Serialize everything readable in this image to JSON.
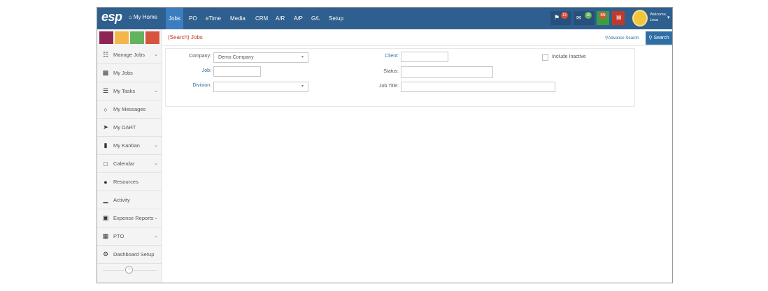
{
  "brand": "esp",
  "nav": {
    "home_label": "My Home",
    "items": [
      "Jobs",
      "PO",
      "eTime",
      "Media",
      "CRM",
      "A/R",
      "A/P",
      "G/L",
      "Setup"
    ],
    "active": "Jobs"
  },
  "header": {
    "badges": {
      "alerts": "13",
      "messages": "18",
      "user_initials": "BN"
    },
    "welcome_line1": "Welcome,",
    "welcome_line2": "Lesa"
  },
  "colors": {
    "nav_bg": "#2f5f8f",
    "swatches": [
      "#8e2451",
      "#f3b64a",
      "#62b35d",
      "#d7553f"
    ]
  },
  "sidebar": {
    "items": [
      {
        "label": "Manage Jobs",
        "icon": "sitemap-icon",
        "chevron": true
      },
      {
        "label": "My Jobs",
        "icon": "folder-open-icon",
        "chevron": false
      },
      {
        "label": "My Tasks",
        "icon": "tasks-icon",
        "chevron": true
      },
      {
        "label": "My Messages",
        "icon": "chat-icon",
        "chevron": false
      },
      {
        "label": "My DART",
        "icon": "dart-icon",
        "chevron": false
      },
      {
        "label": "My Kanban",
        "icon": "kanban-icon",
        "chevron": true
      },
      {
        "label": "Calendar",
        "icon": "calendar-icon",
        "chevron": true
      },
      {
        "label": "Resources",
        "icon": "users-icon",
        "chevron": false
      },
      {
        "label": "Activity",
        "icon": "bar-chart-icon",
        "chevron": false
      },
      {
        "label": "Expense Reports",
        "icon": "money-icon",
        "chevron": true
      },
      {
        "label": "PTO",
        "icon": "calendar-grid-icon",
        "chevron": true
      },
      {
        "label": "Dashboard Setup",
        "icon": "gears-icon",
        "chevron": false
      }
    ]
  },
  "main": {
    "title": "(Search) Jobs",
    "advance_search": "Advance Search",
    "search_button": "Search"
  },
  "form": {
    "company_label": "Company:",
    "company_value": "Demo Company",
    "job_label": "Job:",
    "job_value": "",
    "division_label": "Division:",
    "division_value": "",
    "client_label": "Client:",
    "client_value": "",
    "status_label": "Status:",
    "status_value": "",
    "job_title_label": "Job Title:",
    "job_title_value": "",
    "include_inactive_label": "Include Inactive"
  }
}
